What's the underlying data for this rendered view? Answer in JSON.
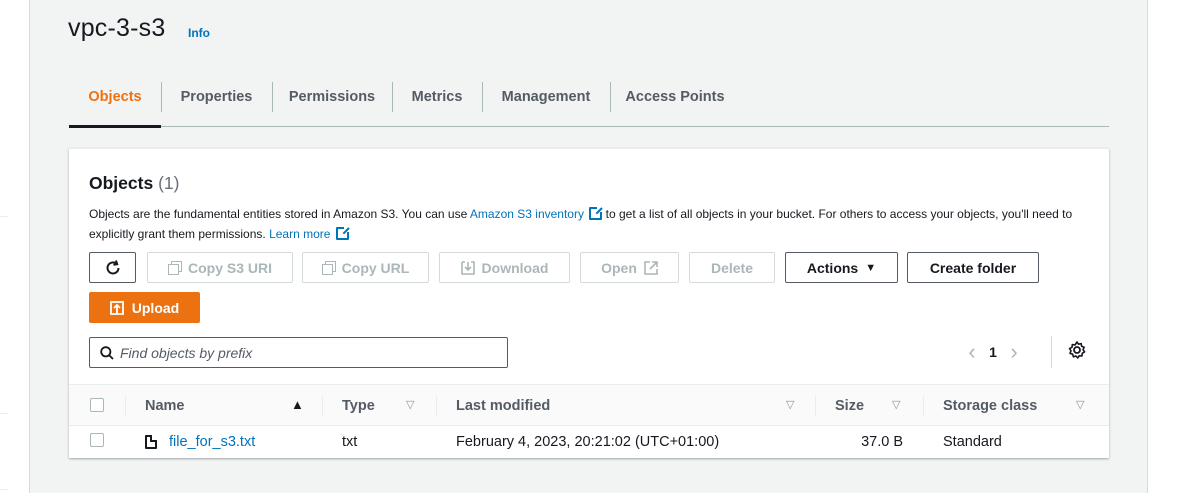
{
  "page": {
    "title": "vpc-3-s3",
    "info_label": "Info"
  },
  "tabs": [
    {
      "label": "Objects",
      "active": true
    },
    {
      "label": "Properties",
      "active": false
    },
    {
      "label": "Permissions",
      "active": false
    },
    {
      "label": "Metrics",
      "active": false
    },
    {
      "label": "Management",
      "active": false
    },
    {
      "label": "Access Points",
      "active": false
    }
  ],
  "objects_panel": {
    "title": "Objects",
    "count": "(1)",
    "description_part1": "Objects are the fundamental entities stored in Amazon S3. You can use ",
    "inventory_link": "Amazon S3 inventory",
    "description_part2": " to get a list of all objects in your bucket. For others to access your objects, you'll need to explicitly grant them permissions. ",
    "learn_more_link": "Learn more"
  },
  "toolbar": {
    "refresh_icon": "refresh-icon",
    "copy_s3_uri": "Copy S3 URI",
    "copy_url": "Copy URL",
    "download": "Download",
    "open": "Open",
    "delete": "Delete",
    "actions": "Actions",
    "create_folder": "Create folder",
    "upload": "Upload"
  },
  "search": {
    "placeholder": "Find objects by prefix",
    "value": ""
  },
  "pagination": {
    "current_page": "1",
    "prev": "‹",
    "next": "›"
  },
  "table": {
    "columns": [
      "Name",
      "Type",
      "Last modified",
      "Size",
      "Storage class"
    ],
    "sorted_by": "Name",
    "rows": [
      {
        "name": "file_for_s3.txt",
        "type": "txt",
        "last_modified": "February 4, 2023, 20:21:02 (UTC+01:00)",
        "size": "37.0 B",
        "storage_class": "Standard"
      }
    ]
  },
  "colors": {
    "accent": "#ec7211",
    "link": "#0073bb",
    "text": "#16191f",
    "muted": "#545b64",
    "disabled": "#aab7b8"
  }
}
